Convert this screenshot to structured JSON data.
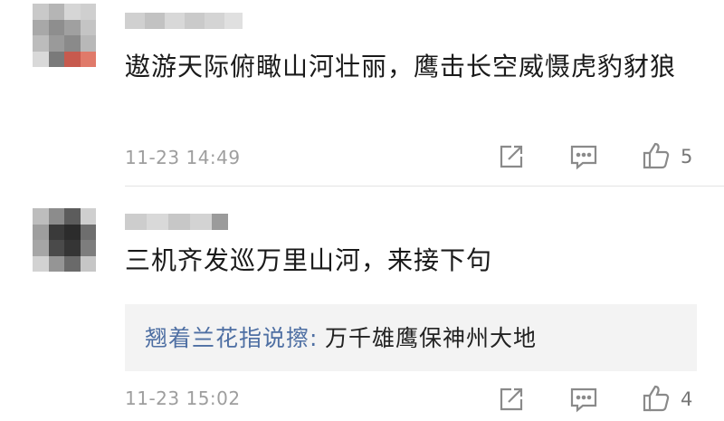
{
  "comments": [
    {
      "text": "遨游天际俯瞰山河壮丽，鹰击长空威慑虎豹豺狼",
      "time": "11-23 14:49",
      "likes": "5"
    },
    {
      "text": "三机齐发巡万里山河，来接下句",
      "reply": {
        "author": "翘着兰花指说擦:",
        "text": "万千雄鹰保神州大地"
      },
      "time": "11-23 15:02",
      "likes": "4"
    }
  ],
  "icons": {
    "share": "share-icon",
    "comment": "comment-icon",
    "like": "thumbs-up-icon"
  },
  "colors": {
    "reply_author": "#4e6fa3",
    "timestamp": "#9e9e9e",
    "reply_bg": "#f3f3f3"
  }
}
